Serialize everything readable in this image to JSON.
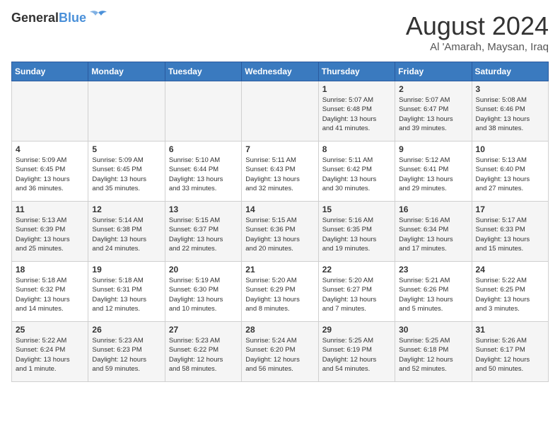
{
  "header": {
    "logo_line1": "General",
    "logo_line2": "Blue",
    "month_title": "August 2024",
    "location": "Al 'Amarah, Maysan, Iraq"
  },
  "weekdays": [
    "Sunday",
    "Monday",
    "Tuesday",
    "Wednesday",
    "Thursday",
    "Friday",
    "Saturday"
  ],
  "weeks": [
    [
      {
        "day": "",
        "info": ""
      },
      {
        "day": "",
        "info": ""
      },
      {
        "day": "",
        "info": ""
      },
      {
        "day": "",
        "info": ""
      },
      {
        "day": "1",
        "info": "Sunrise: 5:07 AM\nSunset: 6:48 PM\nDaylight: 13 hours\nand 41 minutes."
      },
      {
        "day": "2",
        "info": "Sunrise: 5:07 AM\nSunset: 6:47 PM\nDaylight: 13 hours\nand 39 minutes."
      },
      {
        "day": "3",
        "info": "Sunrise: 5:08 AM\nSunset: 6:46 PM\nDaylight: 13 hours\nand 38 minutes."
      }
    ],
    [
      {
        "day": "4",
        "info": "Sunrise: 5:09 AM\nSunset: 6:45 PM\nDaylight: 13 hours\nand 36 minutes."
      },
      {
        "day": "5",
        "info": "Sunrise: 5:09 AM\nSunset: 6:45 PM\nDaylight: 13 hours\nand 35 minutes."
      },
      {
        "day": "6",
        "info": "Sunrise: 5:10 AM\nSunset: 6:44 PM\nDaylight: 13 hours\nand 33 minutes."
      },
      {
        "day": "7",
        "info": "Sunrise: 5:11 AM\nSunset: 6:43 PM\nDaylight: 13 hours\nand 32 minutes."
      },
      {
        "day": "8",
        "info": "Sunrise: 5:11 AM\nSunset: 6:42 PM\nDaylight: 13 hours\nand 30 minutes."
      },
      {
        "day": "9",
        "info": "Sunrise: 5:12 AM\nSunset: 6:41 PM\nDaylight: 13 hours\nand 29 minutes."
      },
      {
        "day": "10",
        "info": "Sunrise: 5:13 AM\nSunset: 6:40 PM\nDaylight: 13 hours\nand 27 minutes."
      }
    ],
    [
      {
        "day": "11",
        "info": "Sunrise: 5:13 AM\nSunset: 6:39 PM\nDaylight: 13 hours\nand 25 minutes."
      },
      {
        "day": "12",
        "info": "Sunrise: 5:14 AM\nSunset: 6:38 PM\nDaylight: 13 hours\nand 24 minutes."
      },
      {
        "day": "13",
        "info": "Sunrise: 5:15 AM\nSunset: 6:37 PM\nDaylight: 13 hours\nand 22 minutes."
      },
      {
        "day": "14",
        "info": "Sunrise: 5:15 AM\nSunset: 6:36 PM\nDaylight: 13 hours\nand 20 minutes."
      },
      {
        "day": "15",
        "info": "Sunrise: 5:16 AM\nSunset: 6:35 PM\nDaylight: 13 hours\nand 19 minutes."
      },
      {
        "day": "16",
        "info": "Sunrise: 5:16 AM\nSunset: 6:34 PM\nDaylight: 13 hours\nand 17 minutes."
      },
      {
        "day": "17",
        "info": "Sunrise: 5:17 AM\nSunset: 6:33 PM\nDaylight: 13 hours\nand 15 minutes."
      }
    ],
    [
      {
        "day": "18",
        "info": "Sunrise: 5:18 AM\nSunset: 6:32 PM\nDaylight: 13 hours\nand 14 minutes."
      },
      {
        "day": "19",
        "info": "Sunrise: 5:18 AM\nSunset: 6:31 PM\nDaylight: 13 hours\nand 12 minutes."
      },
      {
        "day": "20",
        "info": "Sunrise: 5:19 AM\nSunset: 6:30 PM\nDaylight: 13 hours\nand 10 minutes."
      },
      {
        "day": "21",
        "info": "Sunrise: 5:20 AM\nSunset: 6:29 PM\nDaylight: 13 hours\nand 8 minutes."
      },
      {
        "day": "22",
        "info": "Sunrise: 5:20 AM\nSunset: 6:27 PM\nDaylight: 13 hours\nand 7 minutes."
      },
      {
        "day": "23",
        "info": "Sunrise: 5:21 AM\nSunset: 6:26 PM\nDaylight: 13 hours\nand 5 minutes."
      },
      {
        "day": "24",
        "info": "Sunrise: 5:22 AM\nSunset: 6:25 PM\nDaylight: 13 hours\nand 3 minutes."
      }
    ],
    [
      {
        "day": "25",
        "info": "Sunrise: 5:22 AM\nSunset: 6:24 PM\nDaylight: 13 hours\nand 1 minute."
      },
      {
        "day": "26",
        "info": "Sunrise: 5:23 AM\nSunset: 6:23 PM\nDaylight: 12 hours\nand 59 minutes."
      },
      {
        "day": "27",
        "info": "Sunrise: 5:23 AM\nSunset: 6:22 PM\nDaylight: 12 hours\nand 58 minutes."
      },
      {
        "day": "28",
        "info": "Sunrise: 5:24 AM\nSunset: 6:20 PM\nDaylight: 12 hours\nand 56 minutes."
      },
      {
        "day": "29",
        "info": "Sunrise: 5:25 AM\nSunset: 6:19 PM\nDaylight: 12 hours\nand 54 minutes."
      },
      {
        "day": "30",
        "info": "Sunrise: 5:25 AM\nSunset: 6:18 PM\nDaylight: 12 hours\nand 52 minutes."
      },
      {
        "day": "31",
        "info": "Sunrise: 5:26 AM\nSunset: 6:17 PM\nDaylight: 12 hours\nand 50 minutes."
      }
    ]
  ]
}
